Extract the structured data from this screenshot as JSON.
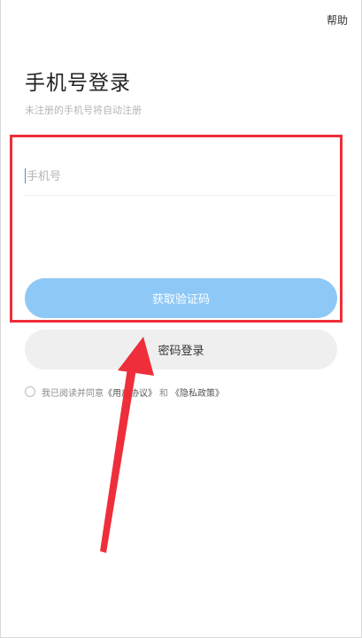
{
  "header": {
    "help_label": "帮助"
  },
  "login": {
    "title": "手机号登录",
    "subtitle": "未注册的手机号将自动注册",
    "phone_placeholder": "手机号",
    "phone_value": "",
    "get_code_label": "获取验证码",
    "password_login_label": "密码登录"
  },
  "agreement": {
    "prefix": "我已阅读并同意",
    "user_agreement": "《用户协议》",
    "and": "和",
    "privacy_policy": "《隐私政策》"
  },
  "colors": {
    "annotation_red": "#ee2e3a",
    "primary_button": "#8ec8f6",
    "secondary_button": "#efefef",
    "cursor_blue": "#3b8cf0"
  }
}
